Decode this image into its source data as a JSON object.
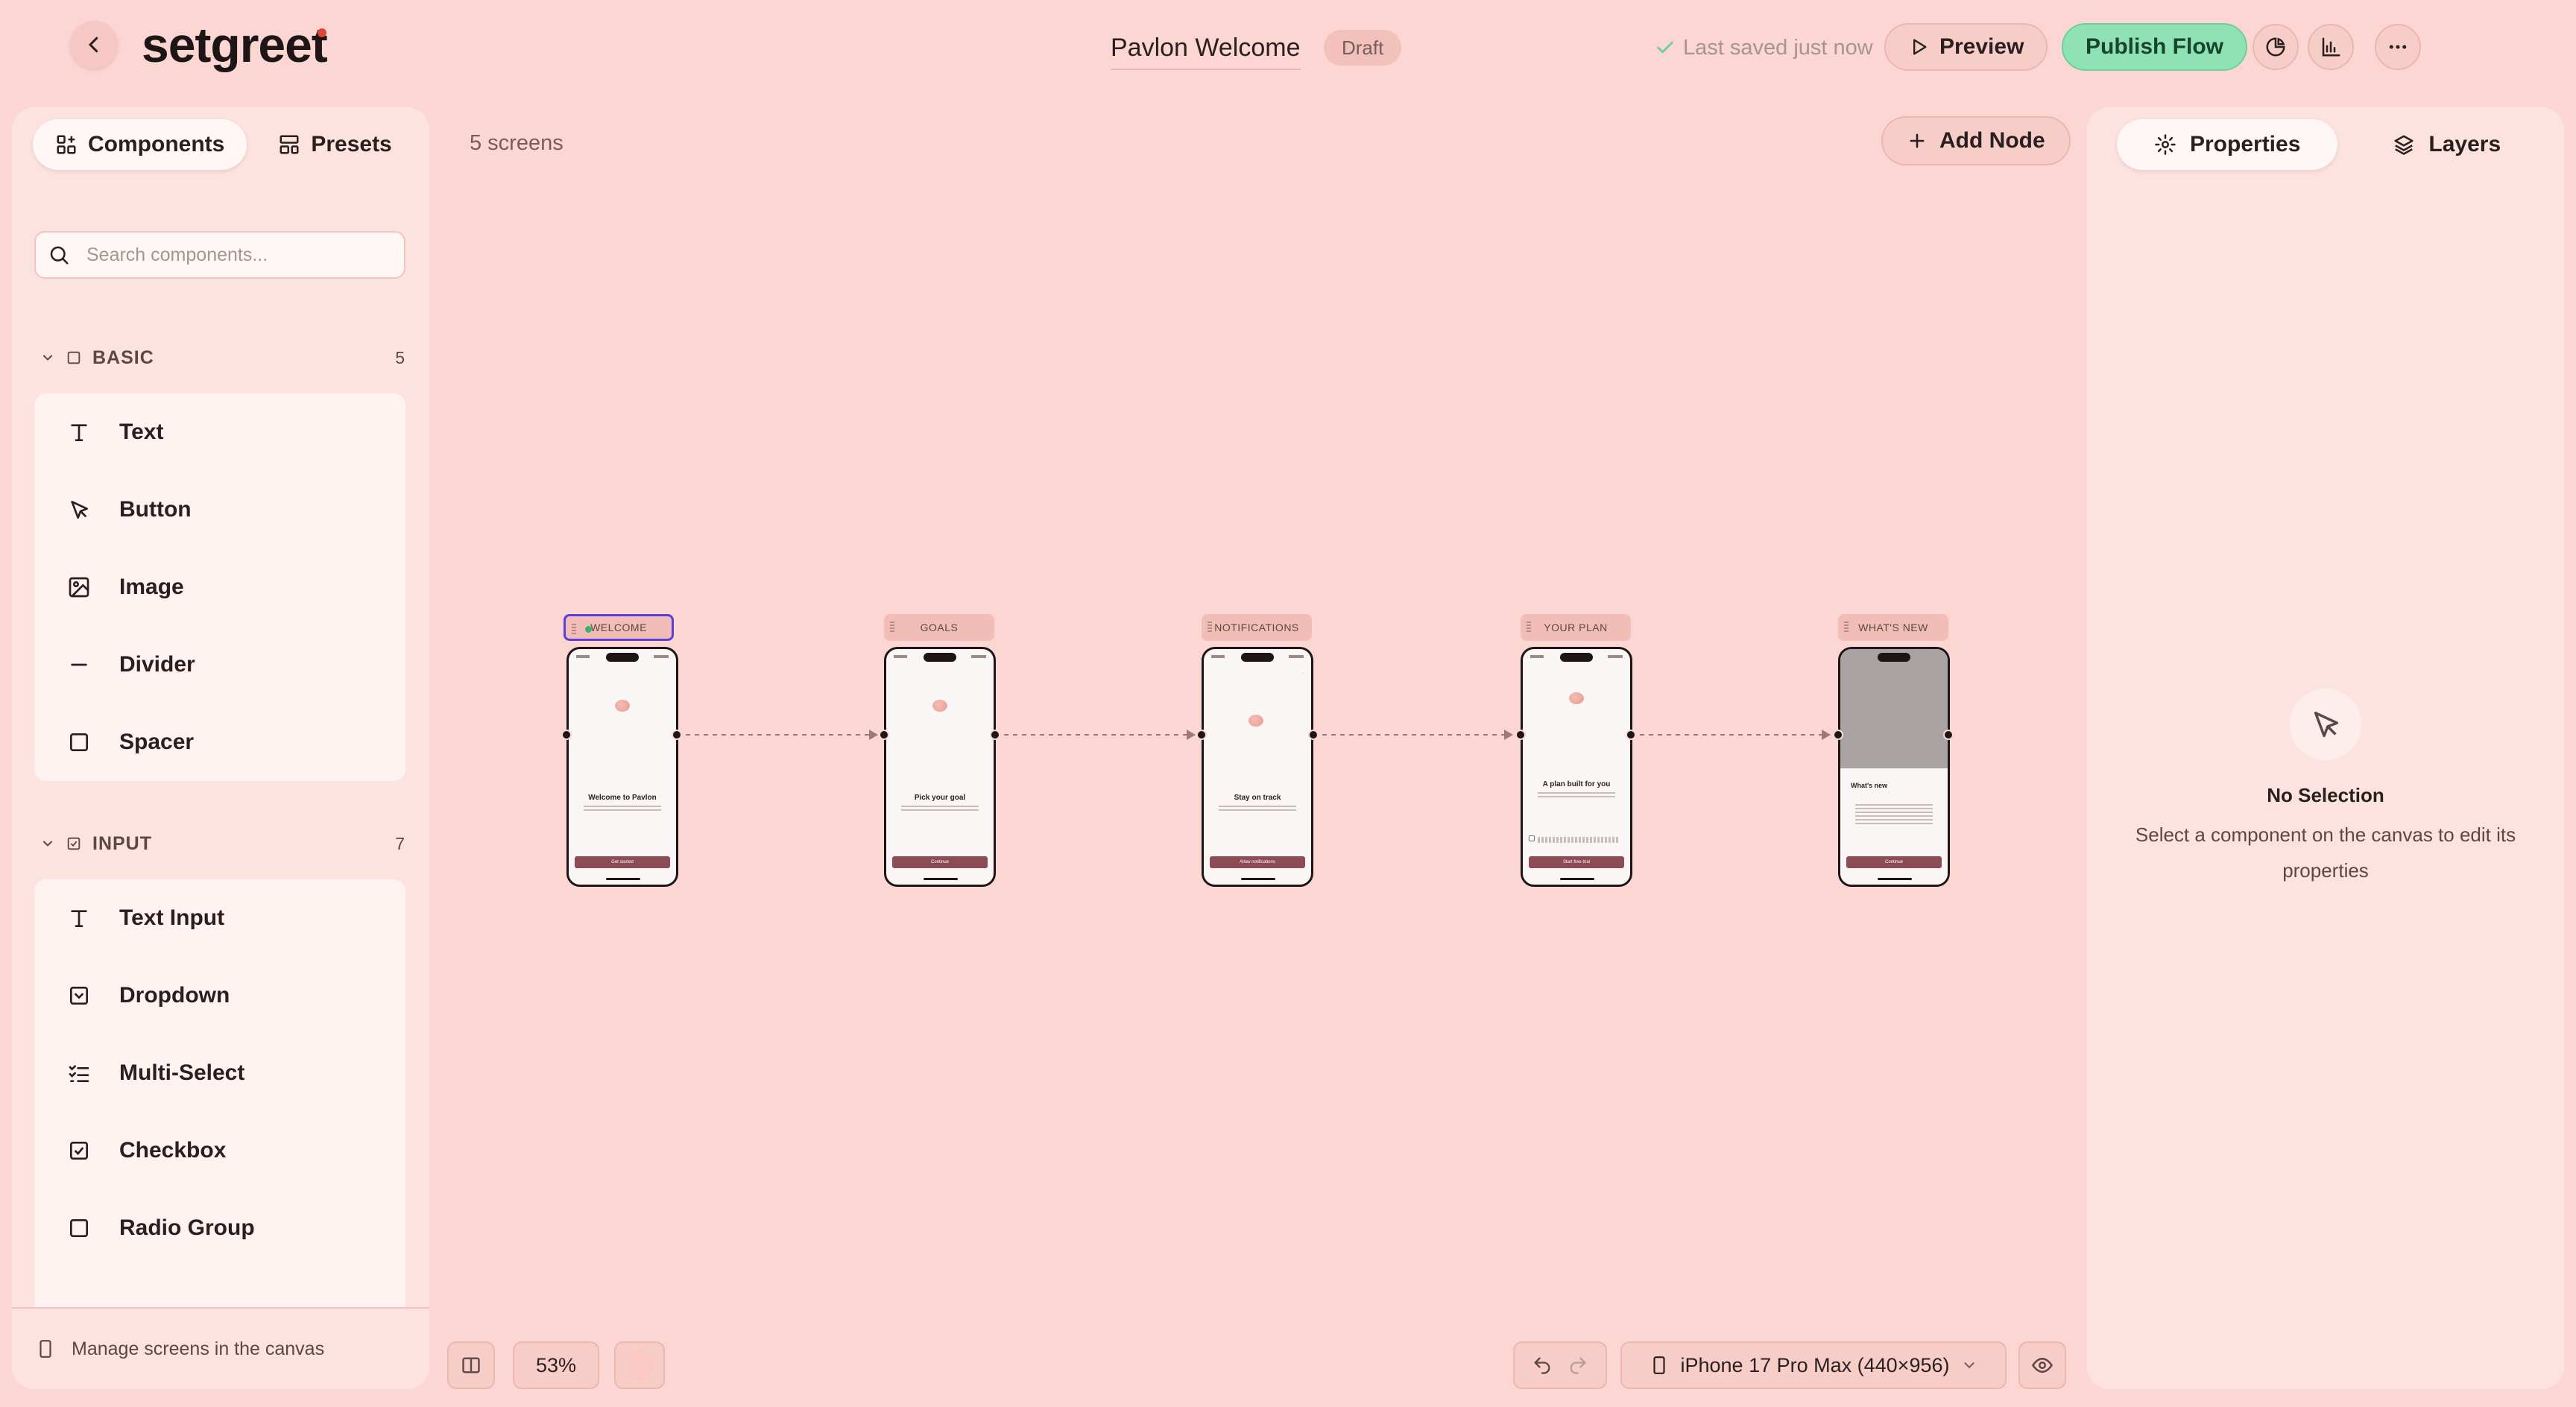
{
  "header": {
    "logo_text": "setgreet",
    "flow_title": "Pavlon Welcome",
    "status_badge": "Draft",
    "saved_text": "Last saved just now",
    "preview_label": "Preview",
    "publish_label": "Publish Flow"
  },
  "left_panel": {
    "tabs": [
      {
        "label": "Components",
        "icon": "components-icon",
        "active": true
      },
      {
        "label": "Presets",
        "icon": "presets-icon",
        "active": false
      }
    ],
    "search_placeholder": "Search components...",
    "sections": [
      {
        "title": "BASIC",
        "count": "5",
        "items": [
          {
            "label": "Text",
            "icon": "text-icon"
          },
          {
            "label": "Button",
            "icon": "cursor-icon"
          },
          {
            "label": "Image",
            "icon": "image-icon"
          },
          {
            "label": "Divider",
            "icon": "divider-icon"
          },
          {
            "label": "Spacer",
            "icon": "spacer-icon"
          }
        ]
      },
      {
        "title": "INPUT",
        "count": "7",
        "items": [
          {
            "label": "Text Input",
            "icon": "text-icon"
          },
          {
            "label": "Dropdown",
            "icon": "dropdown-icon"
          },
          {
            "label": "Multi-Select",
            "icon": "list-check-icon"
          },
          {
            "label": "Checkbox",
            "icon": "checkbox-icon"
          },
          {
            "label": "Radio Group",
            "icon": "square-icon"
          }
        ]
      }
    ],
    "footer_text": "Manage screens in the canvas"
  },
  "canvas": {
    "screens_count": "5 screens",
    "add_node_label": "Add Node",
    "screens": [
      {
        "label": "WELCOME",
        "selected": true,
        "title": "Welcome to Pavlon",
        "button": "Get started"
      },
      {
        "label": "GOALS",
        "selected": false,
        "title": "Pick your goal",
        "button": "Continue"
      },
      {
        "label": "NOTIFICATIONS",
        "selected": false,
        "title": "Stay on track",
        "button": "Allow notifications"
      },
      {
        "label": "YOUR PLAN",
        "selected": false,
        "title": "A plan built for you",
        "button": "Start free trial"
      },
      {
        "label": "WHAT'S NEW",
        "selected": false,
        "title": "What's new",
        "button": "Continue"
      }
    ],
    "zoom": "53%",
    "device": "iPhone 17 Pro Max (440×956)"
  },
  "right_panel": {
    "tabs": [
      {
        "label": "Properties",
        "icon": "gear-icon",
        "active": true
      },
      {
        "label": "Layers",
        "icon": "layers-icon",
        "active": false
      }
    ],
    "empty_title": "No Selection",
    "empty_desc": "Select a component on the canvas to edit its properties"
  },
  "colors": {
    "background": "#fbd6d2",
    "panel": "#fde3e0",
    "publish": "#8fe2b3",
    "selected_outline": "#5b3fd6",
    "phone_button": "#8c4b55"
  }
}
